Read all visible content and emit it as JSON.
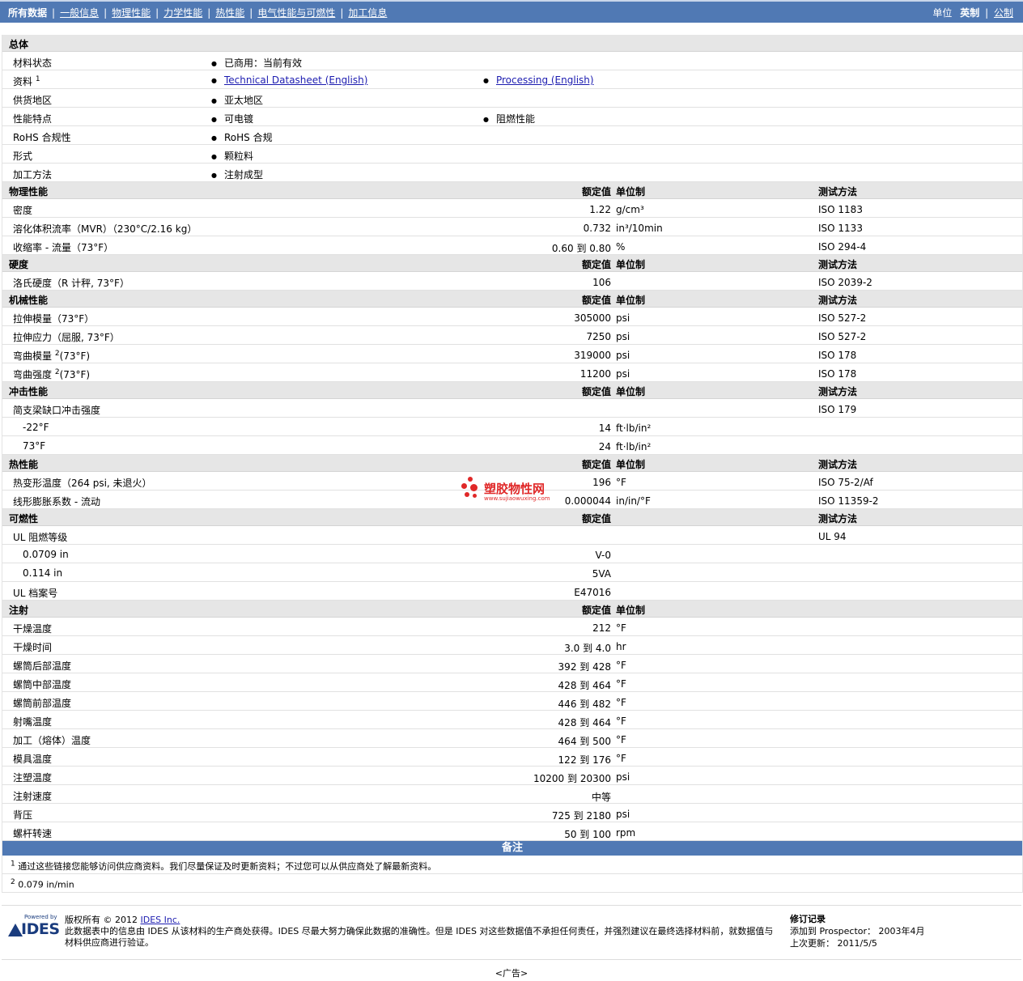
{
  "nav": {
    "tabs": [
      "所有数据",
      "一般信息",
      "物理性能",
      "力学性能",
      "热性能",
      "电气性能与可燃性",
      "加工信息"
    ],
    "units_label": "单位",
    "unit_current": "英制",
    "unit_alt": "公制"
  },
  "general": {
    "title": "总体",
    "rows": [
      {
        "label": "材料状态",
        "sup": "",
        "items": [
          "已商用：当前有效"
        ],
        "links": false
      },
      {
        "label": "资料",
        "sup": "1",
        "items": [
          "Technical Datasheet (English)",
          "Processing (English)"
        ],
        "links": true
      },
      {
        "label": "供货地区",
        "sup": "",
        "items": [
          "亚太地区"
        ],
        "links": false
      },
      {
        "label": "性能特点",
        "sup": "",
        "items": [
          "可电镀",
          "阻燃性能"
        ],
        "links": false
      },
      {
        "label": "RoHS 合规性",
        "sup": "",
        "items": [
          "RoHS 合规"
        ],
        "links": false
      },
      {
        "label": "形式",
        "sup": "",
        "items": [
          "颗粒料"
        ],
        "links": false
      },
      {
        "label": "加工方法",
        "sup": "",
        "items": [
          "注射成型"
        ],
        "links": false
      }
    ]
  },
  "col_headers": {
    "value": "额定值",
    "unit": "单位制",
    "test": "测试方法"
  },
  "sections": [
    {
      "title": "物理性能",
      "show_unit": true,
      "show_test": true,
      "rows": [
        {
          "label": "密度",
          "sup": "",
          "sub": false,
          "value": "1.22",
          "unit": "g/cm³",
          "test": "ISO 1183"
        },
        {
          "label": "溶化体积流率（MVR）（230°C/2.16 kg）",
          "sup": "",
          "sub": false,
          "value": "0.732",
          "unit": "in³/10min",
          "test": "ISO 1133"
        },
        {
          "label": "收缩率 - 流量（73°F）",
          "sup": "",
          "sub": false,
          "value": "0.60 到  0.80",
          "unit": "%",
          "test": "ISO 294-4"
        }
      ]
    },
    {
      "title": "硬度",
      "show_unit": true,
      "show_test": true,
      "rows": [
        {
          "label": "洛氏硬度（R 计秤, 73°F）",
          "sup": "",
          "sub": false,
          "value": "106",
          "unit": "",
          "test": "ISO 2039-2"
        }
      ]
    },
    {
      "title": "机械性能",
      "show_unit": true,
      "show_test": true,
      "rows": [
        {
          "label": "拉伸模量（73°F）",
          "sup": "",
          "sub": false,
          "value": "305000",
          "unit": "psi",
          "test": "ISO 527-2"
        },
        {
          "label": "拉伸应力（屈服, 73°F）",
          "sup": "",
          "sub": false,
          "value": "7250",
          "unit": "psi",
          "test": "ISO 527-2"
        },
        {
          "label": "弯曲模量",
          "sup": "2",
          "after": "(73°F)",
          "sub": false,
          "value": "319000",
          "unit": "psi",
          "test": "ISO 178"
        },
        {
          "label": "弯曲强度",
          "sup": "2",
          "after": "(73°F)",
          "sub": false,
          "value": "11200",
          "unit": "psi",
          "test": "ISO 178"
        }
      ]
    },
    {
      "title": "冲击性能",
      "show_unit": true,
      "show_test": true,
      "rows": [
        {
          "label": "简支梁缺口冲击强度",
          "sup": "",
          "sub": false,
          "value": "",
          "unit": "",
          "test": "ISO 179"
        },
        {
          "label": "-22°F",
          "sup": "",
          "sub": true,
          "value": "14",
          "unit": "ft·lb/in²",
          "test": ""
        },
        {
          "label": "73°F",
          "sup": "",
          "sub": true,
          "value": "24",
          "unit": "ft·lb/in²",
          "test": ""
        }
      ]
    },
    {
      "title": "热性能",
      "show_unit": true,
      "show_test": true,
      "rows": [
        {
          "label": "热变形温度（264 psi, 未退火）",
          "sup": "",
          "sub": false,
          "value": "196",
          "unit": "°F",
          "test": "ISO 75-2/Af"
        },
        {
          "label": "线形膨胀系数 - 流动",
          "sup": "",
          "sub": false,
          "value": "0.000044",
          "unit": "in/in/°F",
          "test": "ISO 11359-2"
        }
      ]
    },
    {
      "title": "可燃性",
      "show_unit": false,
      "show_test": true,
      "rows": [
        {
          "label": "UL 阻燃等级",
          "sup": "",
          "sub": false,
          "value": "",
          "unit": "",
          "test": "UL 94"
        },
        {
          "label": "0.0709 in",
          "sup": "",
          "sub": true,
          "value": "V-0",
          "unit": "",
          "test": ""
        },
        {
          "label": "0.114 in",
          "sup": "",
          "sub": true,
          "value": "5VA",
          "unit": "",
          "test": ""
        },
        {
          "label": "UL 档案号",
          "sup": "",
          "sub": false,
          "value": "E47016",
          "unit": "",
          "test": ""
        }
      ]
    },
    {
      "title": "注射",
      "show_unit": true,
      "show_test": false,
      "rows": [
        {
          "label": "干燥温度",
          "sup": "",
          "sub": false,
          "value": "212",
          "unit": "°F",
          "test": ""
        },
        {
          "label": "干燥时间",
          "sup": "",
          "sub": false,
          "value": "3.0 到  4.0",
          "unit": "hr",
          "test": ""
        },
        {
          "label": "螺筒后部温度",
          "sup": "",
          "sub": false,
          "value": "392 到  428",
          "unit": "°F",
          "test": ""
        },
        {
          "label": "螺筒中部温度",
          "sup": "",
          "sub": false,
          "value": "428 到  464",
          "unit": "°F",
          "test": ""
        },
        {
          "label": "螺筒前部温度",
          "sup": "",
          "sub": false,
          "value": "446 到  482",
          "unit": "°F",
          "test": ""
        },
        {
          "label": "射嘴温度",
          "sup": "",
          "sub": false,
          "value": "428 到  464",
          "unit": "°F",
          "test": ""
        },
        {
          "label": "加工（熔体）温度",
          "sup": "",
          "sub": false,
          "value": "464 到  500",
          "unit": "°F",
          "test": ""
        },
        {
          "label": "模具温度",
          "sup": "",
          "sub": false,
          "value": "122 到  176",
          "unit": "°F",
          "test": ""
        },
        {
          "label": "注塑温度",
          "sup": "",
          "sub": false,
          "value": "10200 到  20300",
          "unit": "psi",
          "test": ""
        },
        {
          "label": "注射速度",
          "sup": "",
          "sub": false,
          "value": "中等",
          "unit": "",
          "test": ""
        },
        {
          "label": "背压",
          "sup": "",
          "sub": false,
          "value": "725 到  2180",
          "unit": "psi",
          "test": ""
        },
        {
          "label": "螺杆转速",
          "sup": "",
          "sub": false,
          "value": "50 到  100",
          "unit": "rpm",
          "test": ""
        }
      ]
    }
  ],
  "notes": {
    "title": "备注",
    "items": [
      {
        "num": "1",
        "text": "通过这些链接您能够访问供应商资料。我们尽量保证及时更新资料；不过您可以从供应商处了解最新资料。"
      },
      {
        "num": "2",
        "text": "0.079 in/min"
      }
    ]
  },
  "footer": {
    "logo_powered": "Powered by",
    "logo_text": "IDES",
    "copyright": "版权所有 © 2012",
    "company_link": "IDES Inc.",
    "disclaimer": "此数据表中的信息由 IDES 从该材料的生产商处获得。IDES 尽最大努力确保此数据的准确性。但是 IDES 对这些数据值不承担任何责任，并强烈建议在最终选择材料前，就数据值与材料供应商进行验证。",
    "revision_title": "修订记录",
    "added_label": "添加到 Prospector：",
    "added_date": "2003年4月",
    "updated_label": "上次更新：",
    "updated_date": "2011/5/5"
  },
  "ad_label": "<广告>",
  "watermark": {
    "name": "塑胶物性网",
    "url": "www.sujiaowuxing.com"
  }
}
